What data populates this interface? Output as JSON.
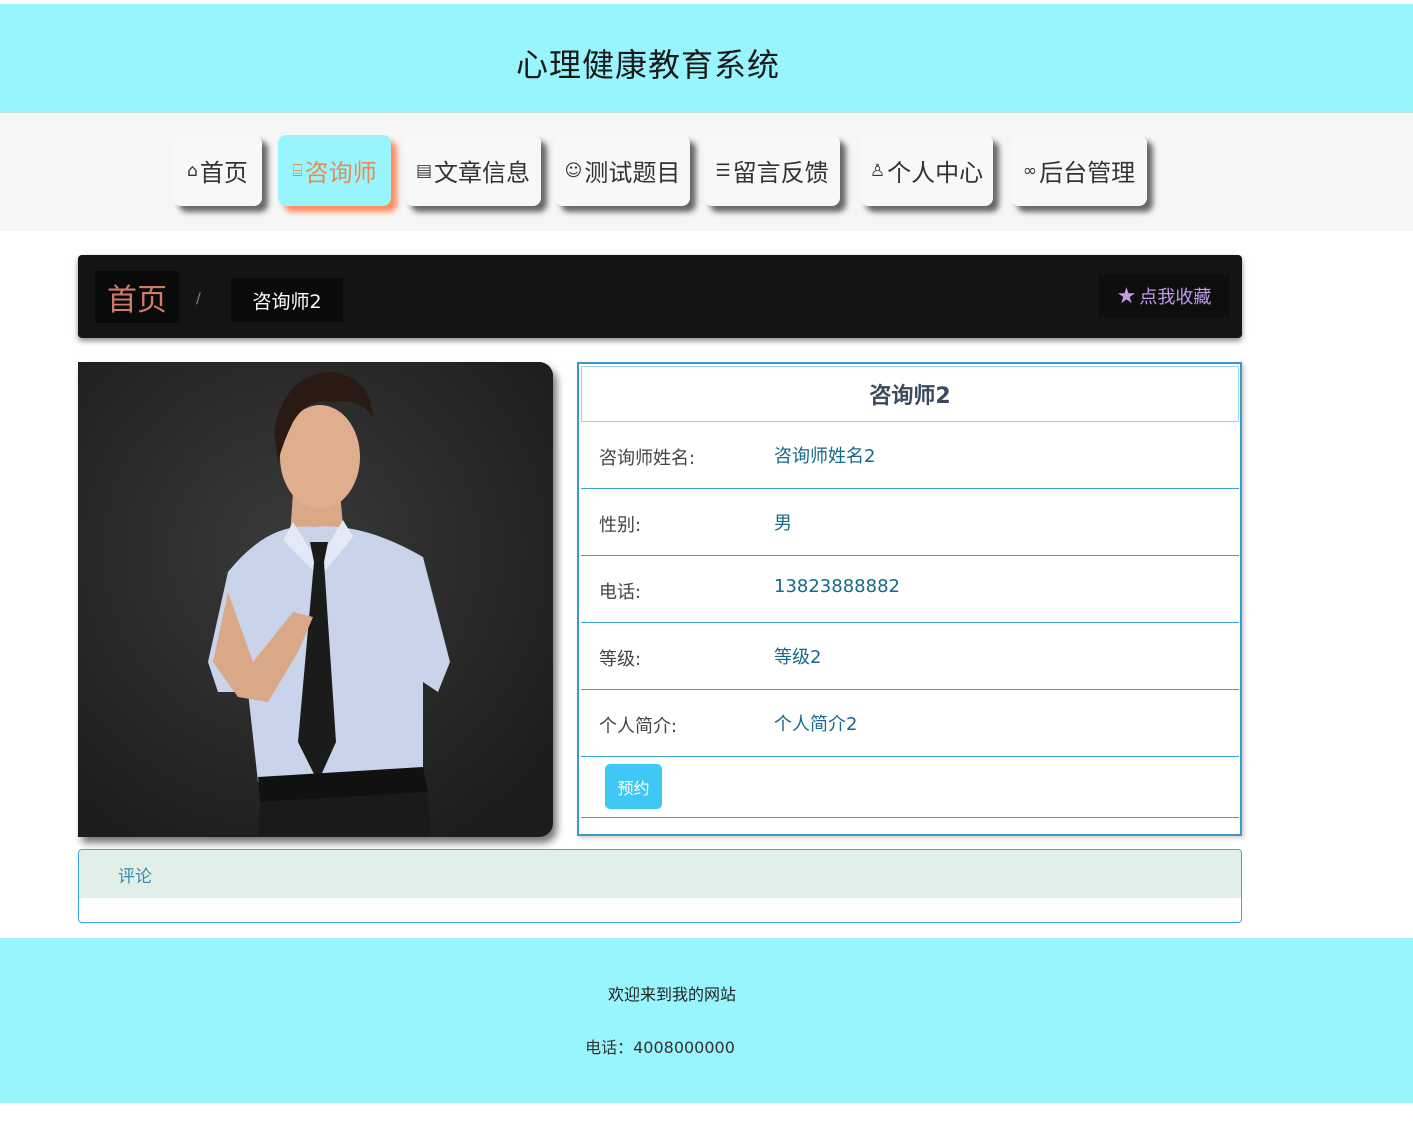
{
  "header": {
    "title": "心理健康教育系统"
  },
  "nav": {
    "items": [
      {
        "label": "首页",
        "icon": "home-icon",
        "glyph": "⌂"
      },
      {
        "label": "咨询师",
        "icon": "gift-icon",
        "glyph": "⌸",
        "active": true
      },
      {
        "label": "文章信息",
        "icon": "newspaper-icon",
        "glyph": "▤"
      },
      {
        "label": "测试题目",
        "icon": "face-icon",
        "glyph": "☺"
      },
      {
        "label": "留言反馈",
        "icon": "sliders-icon",
        "glyph": "☰"
      },
      {
        "label": "个人中心",
        "icon": "person-icon",
        "glyph": "♙"
      },
      {
        "label": "后台管理",
        "icon": "link-icon",
        "glyph": "∞"
      }
    ],
    "active_color": "#e58b58",
    "active_bg": "#99f5fd"
  },
  "breadcrumb": {
    "home": "首页",
    "separator": "/",
    "current": "咨询师2",
    "favorite_label": "点我收藏",
    "favorite_icon": "star-icon"
  },
  "detail": {
    "title": "咨询师2",
    "fields": [
      {
        "label": "咨询师姓名:",
        "value": "咨询师姓名2"
      },
      {
        "label": "性别:",
        "value": "男"
      },
      {
        "label": "电话:",
        "value": "13823888882"
      },
      {
        "label": "等级:",
        "value": "等级2"
      },
      {
        "label": "个人简介:",
        "value": "个人简介2"
      }
    ],
    "book_label": "预约"
  },
  "comments": {
    "title": "评论"
  },
  "footer": {
    "welcome": "欢迎来到我的网站",
    "phone": "电话：4008000000"
  },
  "colors": {
    "header_bg": "#99f5fd",
    "accent_border": "#3aa0d0",
    "button": "#40c8f4",
    "breadcrumb_bg": "#141414"
  }
}
